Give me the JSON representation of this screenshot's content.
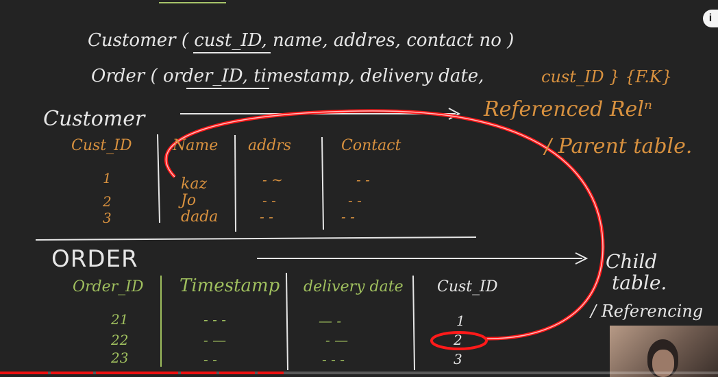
{
  "schema": {
    "customer": "Customer ( cust_ID, name, addres, contact no )",
    "order": "Order ( order_ID, timestamp, delivery date,",
    "order_fk": "cust_ID } {F.K}"
  },
  "customer_table": {
    "title": "Customer",
    "referenced": "Referenced Relⁿ",
    "parent": "/ Parent table.",
    "headers": [
      "Cust_ID",
      "Name",
      "addrs",
      "Contact"
    ],
    "rows": [
      {
        "id": "1",
        "name": "kaz",
        "addr": "- ~",
        "contact": "- -"
      },
      {
        "id": "2",
        "name": "Jo",
        "addr": "- -",
        "contact": "- -"
      },
      {
        "id": "3",
        "name": "dada",
        "addr": "- -",
        "contact": "- -"
      }
    ]
  },
  "order_table": {
    "title": "ORDER",
    "child": "Child",
    "child2": "table.",
    "referencing": "/ Referencing",
    "headers": [
      "Order_ID",
      "Timestamp",
      "delivery date",
      "Cust_ID"
    ],
    "rows": [
      {
        "id": "21",
        "ts": "- - -",
        "dd": "— -",
        "cust": "1"
      },
      {
        "id": "22",
        "ts": "- —",
        "dd": "- —",
        "cust": "2"
      },
      {
        "id": "23",
        "ts": "- -",
        "dd": "- - -",
        "cust": "3"
      }
    ]
  },
  "overlay": {
    "info_icon": "i"
  },
  "colors": {
    "board": "#232323",
    "chalk": "#e6e6e6",
    "orange": "#d8913f",
    "green": "#9fbf5e",
    "highlight": "#ff1a1a"
  },
  "progress": {
    "watched_fraction": 0.4
  }
}
